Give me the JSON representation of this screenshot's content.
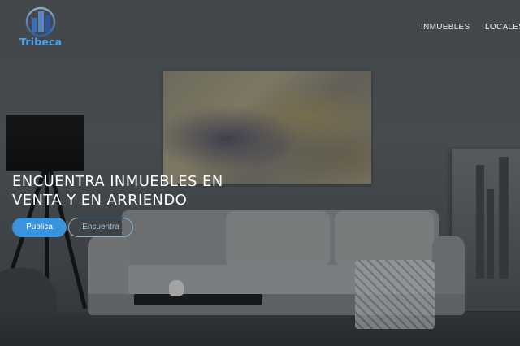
{
  "brand": {
    "name": "Tribeca",
    "logo_icon": "building-skyline-icon",
    "accent_color": "#4aa3ea"
  },
  "nav": {
    "items": [
      {
        "label": "INMUEBLES"
      },
      {
        "label": "LOCALES"
      }
    ]
  },
  "hero": {
    "title_line1": "ENCUENTRA INMUEBLES EN",
    "title_line2": "VENTA Y EN ARRIENDO",
    "primary_button": "Publica",
    "secondary_button": "Encuentra",
    "primary_color": "#3a93dd"
  }
}
